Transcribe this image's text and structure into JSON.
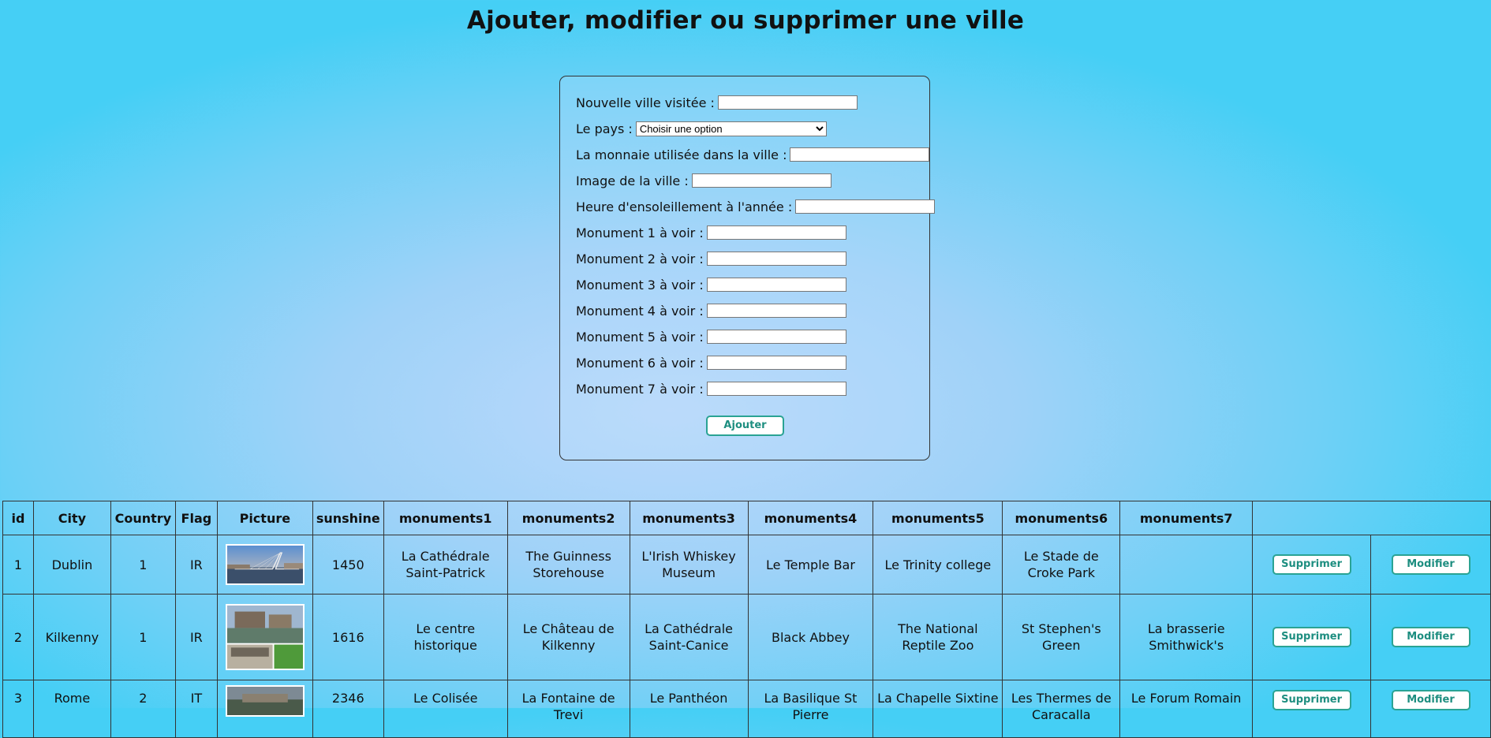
{
  "page": {
    "title": "Ajouter, modifier ou supprimer une ville"
  },
  "form": {
    "fields": [
      {
        "label": "Nouvelle ville visitée :",
        "value": ""
      },
      {
        "label": "Le pays :",
        "type": "select",
        "selected": "Choisir une option"
      },
      {
        "label": "La monnaie utilisée dans la ville :",
        "value": ""
      },
      {
        "label": "Image de la ville :",
        "value": ""
      },
      {
        "label": "Heure d'ensoleillement à l'année :",
        "value": ""
      },
      {
        "label": "Monument 1 à voir :",
        "value": ""
      },
      {
        "label": "Monument 2 à voir :",
        "value": ""
      },
      {
        "label": "Monument 3 à voir :",
        "value": ""
      },
      {
        "label": "Monument 4 à voir :",
        "value": ""
      },
      {
        "label": "Monument 5 à voir :",
        "value": ""
      },
      {
        "label": "Monument 6 à voir :",
        "value": ""
      },
      {
        "label": "Monument 7 à voir :",
        "value": ""
      }
    ],
    "submit_label": "Ajouter"
  },
  "table": {
    "headers": [
      "id",
      "City",
      "Country",
      "Flag",
      "Picture",
      "sunshine",
      "monuments1",
      "monuments2",
      "monuments3",
      "monuments4",
      "monuments5",
      "monuments6",
      "monuments7",
      ""
    ],
    "delete_label": "Supprimer",
    "edit_label": "Modifier",
    "rows": [
      {
        "id": "1",
        "city": "Dublin",
        "country": "1",
        "flag": "IR",
        "sunshine": "1450",
        "monuments": [
          "La Cathédrale Saint-Patrick",
          "The Guinness Storehouse",
          "L'Irish Whiskey Museum",
          "Le Temple Bar",
          "Le Trinity college",
          "Le Stade de Croke Park",
          ""
        ]
      },
      {
        "id": "2",
        "city": "Kilkenny",
        "country": "1",
        "flag": "IR",
        "sunshine": "1616",
        "monuments": [
          "Le centre historique",
          "Le Château de Kilkenny",
          "La Cathédrale Saint-Canice",
          "Black Abbey",
          "The National Reptile Zoo",
          "St Stephen's Green",
          "La brasserie Smithwick's"
        ]
      },
      {
        "id": "3",
        "city": "Rome",
        "country": "2",
        "flag": "IT",
        "sunshine": "2346",
        "monuments": [
          "Le Colisée",
          "La Fontaine de Trevi",
          "Le Panthéon",
          "La Basilique St Pierre",
          "La Chapelle Sixtine",
          "Les Thermes de Caracalla",
          "Le Forum Romain"
        ]
      }
    ]
  },
  "colors": {
    "accent": "#2aa394",
    "background": "#9fd2f8"
  }
}
